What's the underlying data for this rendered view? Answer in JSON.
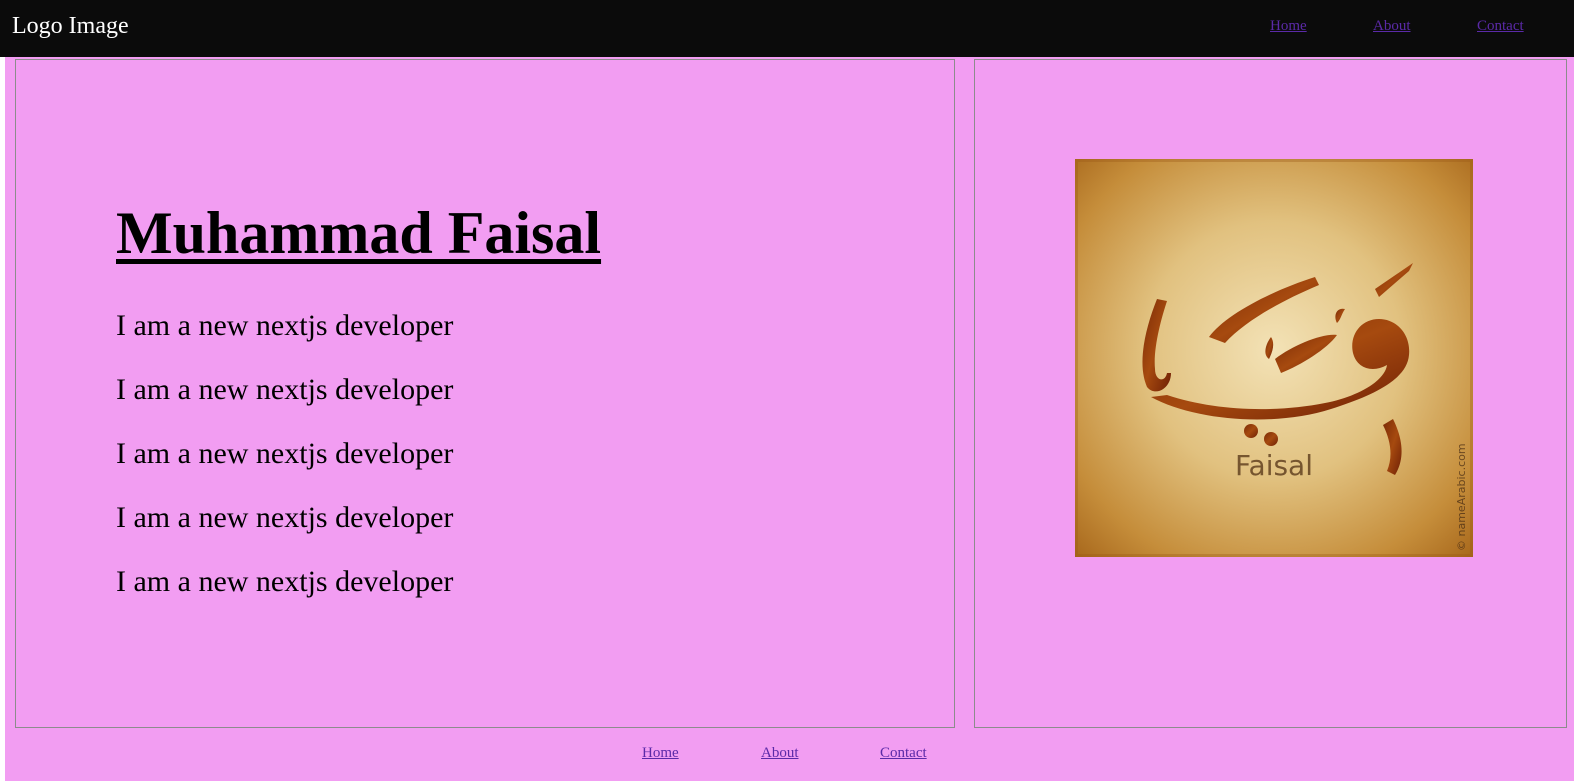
{
  "header": {
    "logo_text": "Logo Image",
    "nav": [
      {
        "label": "Home"
      },
      {
        "label": "About"
      },
      {
        "label": "Contact"
      }
    ]
  },
  "main": {
    "title": "Muhammad Faisal",
    "lines": [
      "I am a new nextjs developer",
      "I am a new nextjs developer",
      "I am a new nextjs developer",
      "I am a new nextjs developer",
      "I am a new nextjs developer"
    ],
    "image": {
      "arabic_text": "فيصل",
      "latin_text": "Faisal",
      "watermark_text": "© nameArabic.com"
    }
  },
  "footer": {
    "nav": [
      {
        "label": "Home"
      },
      {
        "label": "About"
      },
      {
        "label": "Contact"
      }
    ]
  },
  "colors": {
    "header_bg": "#0b0b0b",
    "page_bg": "#f29df2",
    "link": "#5b2aa8",
    "border": "#8c8c8c"
  }
}
